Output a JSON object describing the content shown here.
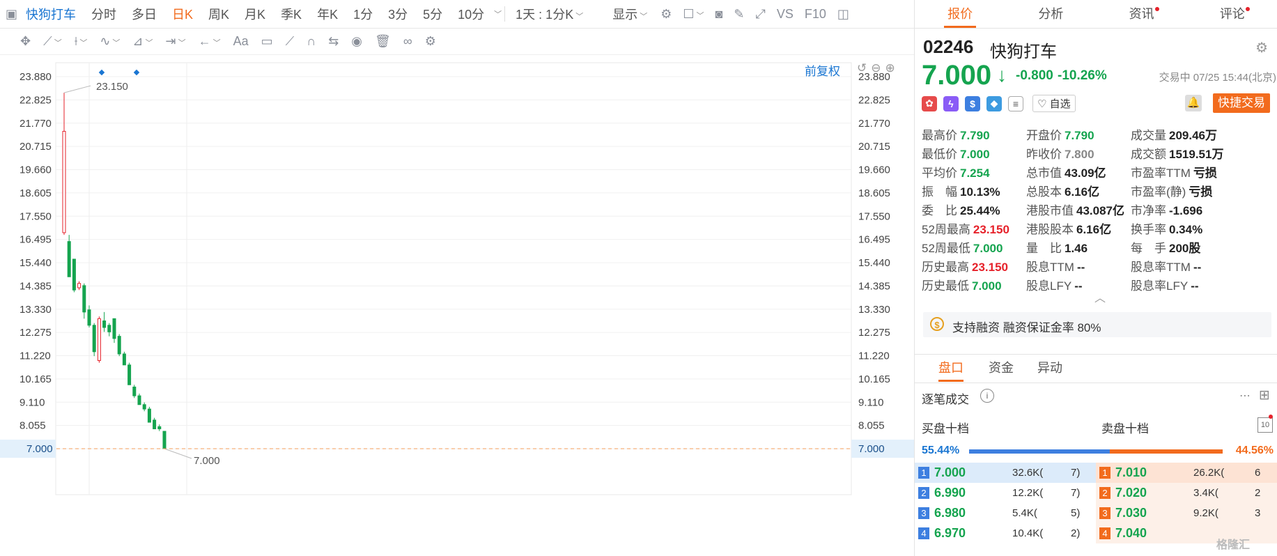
{
  "toolbar": {
    "sidebar_toggle_icon": "panel-toggle-icon",
    "stock_title": "快狗打车",
    "periods": [
      "分时",
      "多日",
      "日K",
      "周K",
      "月K",
      "季K",
      "年K",
      "1分",
      "3分",
      "5分",
      "10分"
    ],
    "active_period": "日K",
    "interval_select": "1天 : 1分K",
    "display_label": "显示",
    "vs_label": "VS",
    "f10_label": "F10",
    "accent_color": "#f26b1d",
    "link_color": "#1a76d2"
  },
  "chart": {
    "restore_label": "前复权",
    "y_ticks": [
      "23.880",
      "22.825",
      "21.770",
      "20.715",
      "19.660",
      "18.605",
      "17.550",
      "16.495",
      "15.440",
      "14.385",
      "13.330",
      "12.275",
      "11.220",
      "10.165",
      "9.110",
      "8.055",
      "7.000"
    ],
    "current_price_tag": "7.000"
  },
  "chart_data": {
    "type": "candlestick",
    "ylim": [
      7.0,
      23.88
    ],
    "high_annotation": "23.150",
    "low_annotation": "7.000",
    "candles": [
      {
        "o": 16.8,
        "h": 23.15,
        "l": 16.7,
        "c": 21.4
      },
      {
        "o": 16.4,
        "h": 16.7,
        "l": 14.8,
        "c": 14.8
      },
      {
        "o": 15.6,
        "h": 15.6,
        "l": 14.1,
        "c": 14.2
      },
      {
        "o": 14.3,
        "h": 14.6,
        "l": 14.2,
        "c": 14.5
      },
      {
        "o": 14.4,
        "h": 14.5,
        "l": 12.9,
        "c": 13.2
      },
      {
        "o": 13.3,
        "h": 13.5,
        "l": 12.5,
        "c": 12.6
      },
      {
        "o": 12.6,
        "h": 12.7,
        "l": 11.2,
        "c": 11.4
      },
      {
        "o": 11.0,
        "h": 13.0,
        "l": 10.9,
        "c": 12.9
      },
      {
        "o": 12.8,
        "h": 13.2,
        "l": 12.3,
        "c": 12.5
      },
      {
        "o": 12.6,
        "h": 12.7,
        "l": 12.1,
        "c": 12.3
      },
      {
        "o": 12.9,
        "h": 12.9,
        "l": 11.8,
        "c": 12.0
      },
      {
        "o": 12.1,
        "h": 12.2,
        "l": 11.2,
        "c": 11.3
      },
      {
        "o": 11.3,
        "h": 11.4,
        "l": 10.8,
        "c": 10.8
      },
      {
        "o": 10.8,
        "h": 10.9,
        "l": 9.9,
        "c": 9.9
      },
      {
        "o": 9.8,
        "h": 9.9,
        "l": 9.3,
        "c": 9.4
      },
      {
        "o": 9.4,
        "h": 9.5,
        "l": 9.0,
        "c": 9.0
      },
      {
        "o": 9.0,
        "h": 9.1,
        "l": 8.7,
        "c": 8.8
      },
      {
        "o": 8.8,
        "h": 8.9,
        "l": 8.2,
        "c": 8.2
      },
      {
        "o": 8.3,
        "h": 8.4,
        "l": 7.9,
        "c": 7.9
      },
      {
        "o": 8.0,
        "h": 8.1,
        "l": 7.8,
        "c": 7.9
      },
      {
        "o": 7.79,
        "h": 7.79,
        "l": 7.0,
        "c": 7.0
      }
    ],
    "up_color": "#e6212a",
    "down_color": "#15a44f"
  },
  "panel": {
    "tabs": [
      {
        "label": "报价",
        "dot": false
      },
      {
        "label": "分析",
        "dot": false
      },
      {
        "label": "资讯",
        "dot": true
      },
      {
        "label": "评论",
        "dot": true
      }
    ],
    "code": "02246",
    "name": "快狗打车",
    "price": "7.000",
    "change": "-0.800",
    "change_pct": "-10.26%",
    "status": "交易中 07/25 15:44(北京)",
    "watch_label": "自选",
    "quick_trade": "快捷交易",
    "stats": [
      [
        {
          "l": "最高价",
          "v": "7.790",
          "c": "green"
        },
        {
          "l": "开盘价",
          "v": "7.790",
          "c": "green"
        },
        {
          "l": "成交量",
          "v": "209.46万",
          "c": "dark"
        }
      ],
      [
        {
          "l": "最低价",
          "v": "7.000",
          "c": "green"
        },
        {
          "l": "昨收价",
          "v": "7.800",
          "c": "gray"
        },
        {
          "l": "成交额",
          "v": "1519.51万",
          "c": "dark"
        }
      ],
      [
        {
          "l": "平均价",
          "v": "7.254",
          "c": "green"
        },
        {
          "l": "总市值",
          "v": "43.09亿",
          "c": "dark"
        },
        {
          "l": "市盈率TTM",
          "v": "亏损",
          "c": "dark"
        }
      ],
      [
        {
          "l": "振　幅",
          "v": "10.13%",
          "c": "dark"
        },
        {
          "l": "总股本",
          "v": "6.16亿",
          "c": "dark"
        },
        {
          "l": "市盈率(静)",
          "v": "亏损",
          "c": "dark"
        }
      ],
      [
        {
          "l": "委　比",
          "v": "25.44%",
          "c": "dark"
        },
        {
          "l": "港股市值",
          "v": "43.087亿",
          "c": "dark"
        },
        {
          "l": "市净率",
          "v": "-1.696",
          "c": "dark"
        }
      ],
      [
        {
          "l": "52周最高",
          "v": "23.150",
          "c": "red"
        },
        {
          "l": "港股股本",
          "v": "6.16亿",
          "c": "dark"
        },
        {
          "l": "换手率",
          "v": "0.34%",
          "c": "dark"
        }
      ],
      [
        {
          "l": "52周最低",
          "v": "7.000",
          "c": "green"
        },
        {
          "l": "量　比",
          "v": "1.46",
          "c": "dark"
        },
        {
          "l": "每　手",
          "v": "200股",
          "c": "dark"
        }
      ],
      [
        {
          "l": "历史最高",
          "v": "23.150",
          "c": "red"
        },
        {
          "l": "股息TTM",
          "v": "--",
          "c": "dark"
        },
        {
          "l": "股息率TTM",
          "v": "--",
          "c": "dark"
        }
      ],
      [
        {
          "l": "历史最低",
          "v": "7.000",
          "c": "green"
        },
        {
          "l": "股息LFY",
          "v": "--",
          "c": "dark"
        },
        {
          "l": "股息率LFY",
          "v": "--",
          "c": "dark"
        }
      ]
    ],
    "margin_text": "支持融资 融资保证金率 80%",
    "sub_tabs": [
      "盘口",
      "资金",
      "异动"
    ],
    "tick_title": "逐笔成交",
    "bid_title": "买盘十档",
    "ask_title": "卖盘十档",
    "bid_pct": "55.44%",
    "ask_pct": "44.56%",
    "bid_ratio": 0.5544,
    "depth": [
      {
        "bid_lvl": "1",
        "bid_price": "7.000",
        "bid_vol": "32.6K(",
        "bid_cnt": "7)",
        "ask_lvl": "1",
        "ask_price": "7.010",
        "ask_vol": "26.2K(",
        "ask_cnt": "6"
      },
      {
        "bid_lvl": "2",
        "bid_price": "6.990",
        "bid_vol": "12.2K(",
        "bid_cnt": "7)",
        "ask_lvl": "2",
        "ask_price": "7.020",
        "ask_vol": "3.4K(",
        "ask_cnt": "2"
      },
      {
        "bid_lvl": "3",
        "bid_price": "6.980",
        "bid_vol": "5.4K(",
        "bid_cnt": "5)",
        "ask_lvl": "3",
        "ask_price": "7.030",
        "ask_vol": "9.2K(",
        "ask_cnt": "3"
      },
      {
        "bid_lvl": "4",
        "bid_price": "6.970",
        "bid_vol": "10.4K(",
        "bid_cnt": "2)",
        "ask_lvl": "4",
        "ask_price": "7.040",
        "ask_vol": "",
        "ask_cnt": ""
      }
    ],
    "watermark": "格隆汇"
  }
}
